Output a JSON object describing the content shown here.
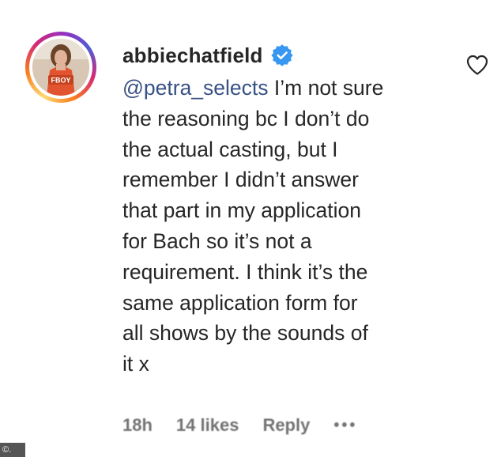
{
  "comment": {
    "username": "abbiechatfield",
    "mention": "@petra_selects",
    "text": " I’m not sure\nthe reasoning bc I don’t do\nthe actual casting, but I\nremember I didn’t answer\nthat part in my application\nfor Bach so it’s not a\nrequirement. I think it’s the\nsame application form for\nall shows by the sounds of\nit x",
    "time": "18h",
    "likes": "14 likes",
    "reply_label": "Reply",
    "more": "•••",
    "avatar_badge": "FBOY"
  },
  "icons": {
    "verified": "verified-badge-icon",
    "like": "heart-icon",
    "more": "more-options-icon"
  },
  "colors": {
    "verified": "#3897f0",
    "mention": "#385185",
    "text": "#262626",
    "meta": "#737373"
  },
  "watermark": "©."
}
